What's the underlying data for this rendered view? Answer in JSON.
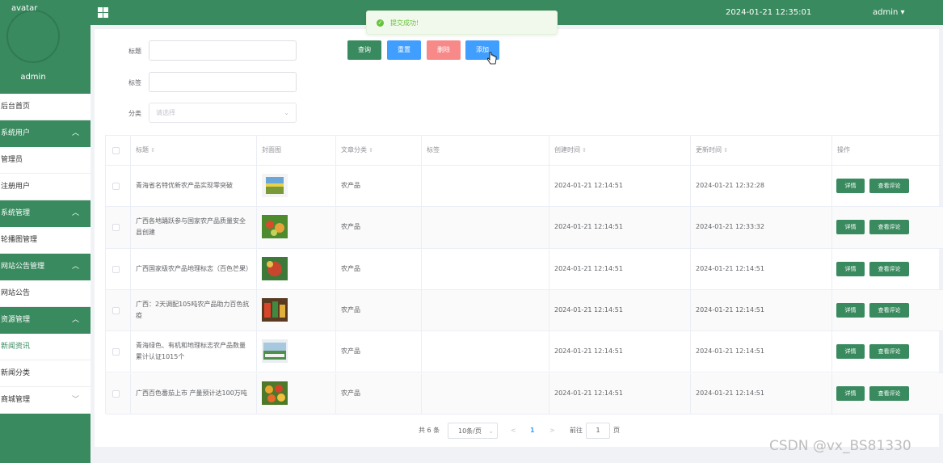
{
  "sidebar": {
    "avatar_text": "avatar",
    "username": "admin",
    "items": [
      {
        "label": "后台首页",
        "type": "item"
      },
      {
        "label": "系统用户",
        "type": "group",
        "chev": "^"
      },
      {
        "label": "管理员",
        "type": "item"
      },
      {
        "label": "注册用户",
        "type": "item"
      },
      {
        "label": "系统管理",
        "type": "group",
        "chev": "^"
      },
      {
        "label": "轮播图管理",
        "type": "item"
      },
      {
        "label": "网站公告管理",
        "type": "group",
        "chev": "^"
      },
      {
        "label": "网站公告",
        "type": "item"
      },
      {
        "label": "资源管理",
        "type": "group",
        "chev": "^"
      },
      {
        "label": "新闻资讯",
        "type": "item",
        "active": true
      },
      {
        "label": "新闻分类",
        "type": "item"
      },
      {
        "label": "商城管理",
        "type": "item",
        "chev": "v"
      }
    ]
  },
  "topbar": {
    "title": "",
    "datetime": "2024-01-21 12:35:01",
    "user": "admin ▾"
  },
  "toast": {
    "message": "提交成功!"
  },
  "search": {
    "title_label": "标题",
    "tag_label": "标签",
    "category_label": "分类",
    "category_placeholder": "请选择",
    "query_btn": "查询",
    "reset_btn": "重置",
    "delete_btn": "删除",
    "add_btn": "添加"
  },
  "colors": {
    "primary": "#3a8a5f",
    "blue": "#409eff",
    "red": "#f78989",
    "add": "#409eff"
  },
  "table": {
    "headers": [
      "标题",
      "封面图",
      "文章分类",
      "标签",
      "创建时间",
      "更新时间",
      "操作"
    ],
    "detail_btn": "详情",
    "comment_btn": "查看评论",
    "rows": [
      {
        "title": "青海省名特优新农产品实现零突破",
        "category": "农产品",
        "tag": "",
        "created": "2024-01-21 12:14:51",
        "updated": "2024-01-21 12:32:28"
      },
      {
        "title": "广西各地踊跃参与国家农产品质量安全县创建",
        "category": "农产品",
        "tag": "",
        "created": "2024-01-21 12:14:51",
        "updated": "2024-01-21 12:33:32"
      },
      {
        "title": "广西国家级农产品地理标志（百色芒果）",
        "category": "农产品",
        "tag": "",
        "created": "2024-01-21 12:14:51",
        "updated": "2024-01-21 12:14:51"
      },
      {
        "title": "广西：2天调配105吨农产品助力百色抗疫",
        "category": "农产品",
        "tag": "",
        "created": "2024-01-21 12:14:51",
        "updated": "2024-01-21 12:14:51"
      },
      {
        "title": "青海绿色、有机和地理标志农产品数量累计认证1015个",
        "category": "农产品",
        "tag": "",
        "created": "2024-01-21 12:14:51",
        "updated": "2024-01-21 12:14:51"
      },
      {
        "title": "广西百色番茄上市 产量预计达100万吨",
        "category": "农产品",
        "tag": "",
        "created": "2024-01-21 12:14:51",
        "updated": "2024-01-21 12:14:51"
      }
    ]
  },
  "pagination": {
    "total": "共 6 条",
    "page_size": "10条/页",
    "prev": "<",
    "current": "1",
    "next": ">",
    "goto_prefix": "前往",
    "goto_value": "1",
    "goto_suffix": "页"
  },
  "watermark": "CSDN @vx_BS81330"
}
